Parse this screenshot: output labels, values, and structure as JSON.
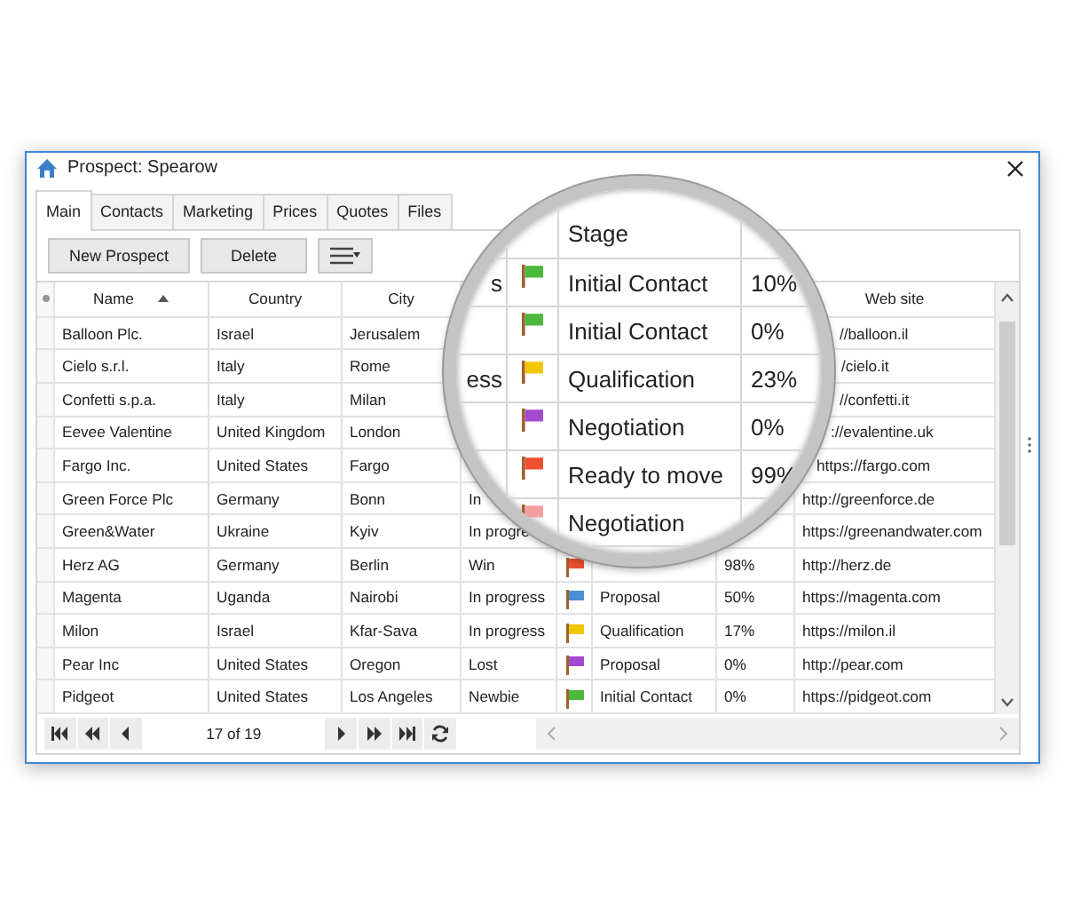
{
  "window": {
    "title": "Prospect: Spearow"
  },
  "tabs": [
    {
      "label": "Main",
      "selected": true
    },
    {
      "label": "Contacts",
      "selected": false
    },
    {
      "label": "Marketing",
      "selected": false
    },
    {
      "label": "Prices",
      "selected": false
    },
    {
      "label": "Quotes",
      "selected": false
    },
    {
      "label": "Files",
      "selected": false
    }
  ],
  "toolbar": {
    "buttons": [
      "New Prospect",
      "Delete"
    ]
  },
  "table": {
    "columns": [
      {
        "label": "Name",
        "sorted": true
      },
      {
        "label": "Country",
        "sorted": false
      },
      {
        "label": "City",
        "sorted": false
      },
      {
        "label": "Web site",
        "sorted": false
      }
    ],
    "rows": [
      {
        "name": "Balloon Plc.",
        "country": "Israel",
        "city": "Jerusalem",
        "web_site": "//balloon.il"
      },
      {
        "name": "Cielo s.r.l.",
        "country": "Italy",
        "city": "Rome",
        "web_site": "/cielo.it"
      },
      {
        "name": "Confetti s.p.a.",
        "country": "Italy",
        "city": "Milan",
        "web_site": "//confetti.it"
      },
      {
        "name": "Eevee Valentine",
        "country": "United Kingdom",
        "city": "London",
        "web_site": "://evalentine.uk"
      },
      {
        "name": "Fargo Inc.",
        "country": "United States",
        "city": "Fargo",
        "web_site": "https://fargo.com"
      },
      {
        "name": "Green Force Plc",
        "country": "Germany",
        "city": "Bonn",
        "status": "In",
        "web_site": "http://greenforce.de"
      },
      {
        "name": "Green&Water",
        "country": "Ukraine",
        "city": "Kyiv",
        "status": "In progre",
        "web_site": "https://greenandwater.com"
      },
      {
        "name": "Herz AG",
        "country": "Germany",
        "city": "Berlin",
        "status": "Win",
        "color": "#e8502c",
        "probability": "98%",
        "web_site": "http://herz.de"
      },
      {
        "name": "Magenta",
        "country": "Uganda",
        "city": "Nairobi",
        "status": "In progress",
        "color": "#4a8fd6",
        "stage": "Proposal",
        "probability": "50%",
        "web_site": "https://magenta.com"
      },
      {
        "name": "Milon",
        "country": "Israel",
        "city": "Kfar-Sava",
        "status": "In progress",
        "color": "#f2c600",
        "stage": "Qualification",
        "probability": "17%",
        "web_site": "https://milon.il"
      },
      {
        "name": "Pear Inc",
        "country": "United States",
        "city": "Oregon",
        "status": "Lost",
        "color": "#a24ad0",
        "stage": "Proposal",
        "probability": "0%",
        "web_site": "http://pear.com"
      },
      {
        "name": "Pidgeot",
        "country": "United States",
        "city": "Los Angeles",
        "status": "Newbie",
        "color": "#4cb83c",
        "stage": "Initial Contact",
        "probability": "0%",
        "web_site": "https://pidgeot.com"
      }
    ]
  },
  "pager": {
    "position": "17 of 19"
  },
  "magnifier": {
    "columns": [
      "Stage"
    ],
    "rows": [
      {
        "status": "s",
        "color": "#4cb83c",
        "stage": "Initial Contact",
        "probability": "10%"
      },
      {
        "color": "#4cb83c",
        "stage": "Initial Contact",
        "probability": "0%"
      },
      {
        "status": "ess",
        "color": "#f2c600",
        "stage": "Qualification",
        "probability": "23%"
      },
      {
        "color": "#a24ad0",
        "stage": "Negotiation",
        "probability": "0%"
      },
      {
        "color": "#f0502c",
        "stage": "Ready to move",
        "probability": "99%"
      },
      {
        "color": "#f4a0a0",
        "stage": "Negotiation"
      }
    ]
  }
}
